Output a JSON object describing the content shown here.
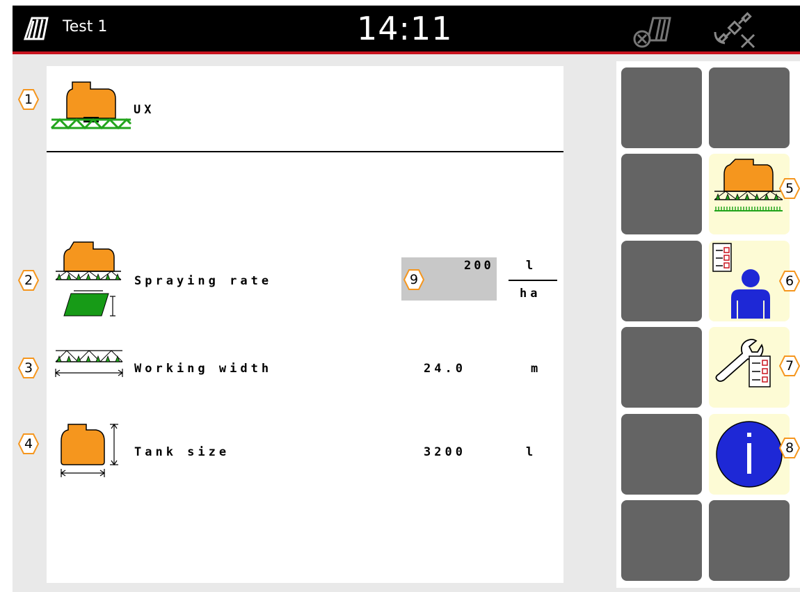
{
  "header": {
    "job_name": "Test 1",
    "time": "14:11"
  },
  "machine": {
    "name": "UX"
  },
  "rows": [
    {
      "callout": "2",
      "label": "Spraying rate",
      "value": "200",
      "unit_top": "l",
      "unit_bottom": "ha",
      "value_callout": "9"
    },
    {
      "callout": "3",
      "label": "Working width",
      "value": "24.0",
      "unit": "m"
    },
    {
      "callout": "4",
      "label": "Tank size",
      "value": "3200",
      "unit": "l"
    }
  ],
  "callouts": {
    "machine": "1",
    "sprayer_softkey": "5",
    "profile_softkey": "6",
    "service_softkey": "7",
    "info_softkey": "8"
  },
  "colors": {
    "topbar": "#000000",
    "accent_red": "#c8141e",
    "tank_orange": "#f5961e",
    "boom_green": "#22a41c",
    "field_green": "#179b17",
    "softkey_grey": "#646464",
    "softkey_active": "#fdfbd5",
    "info_blue": "#1e28d6"
  }
}
